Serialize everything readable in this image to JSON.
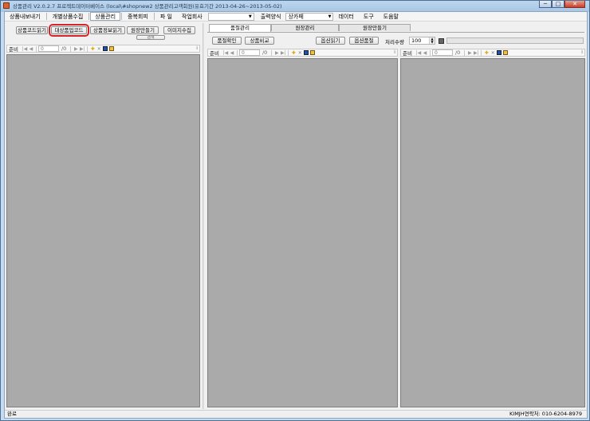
{
  "window": {
    "title": "상품관리 V2.0.2.7 프로젝트데이터베이스 (local\\#shopnew2 상품관리고객회원(유효기간 2013-04-26~2013-05-02)",
    "minimize": "─",
    "maximize": "□",
    "close": "✕"
  },
  "menu": {
    "items": [
      "상품내보내기",
      "개별상품수집",
      "상품관리",
      "중복회피",
      "파 일",
      "작업회사"
    ],
    "output_label": "출력양식",
    "output_value": "상카페",
    "extra_items": [
      "데이터",
      "도구",
      "도움말"
    ]
  },
  "left": {
    "buttons": {
      "product_code_load": "상품코드읽기",
      "bulk_upload_code": "대상품업코드",
      "product_info_load": "상품정보읽기",
      "form_create": "원장만들기",
      "image_collect": "이미지수집",
      "hidden_label": "검색"
    },
    "nav": {
      "ready": "준비",
      "position": "0",
      "of": "/0"
    }
  },
  "right": {
    "tabs": [
      "품절관리",
      "원장관리",
      "원장만들기"
    ],
    "buttons": {
      "soldout_check": "품절확인",
      "product_compare": "상품비교",
      "option_load": "옵션읽기",
      "option_soldout": "옵션품절"
    },
    "process_count_label": "처리수량",
    "process_count_value": "100",
    "progress_value": 0,
    "nav_middle": {
      "ready": "준비",
      "position": "0",
      "of": "/0"
    },
    "nav_right": {
      "ready": "준비",
      "position": "0",
      "of": "/0"
    }
  },
  "status": {
    "left": "완료",
    "right": "KIMJH연락처: 010-6204-8979"
  },
  "colors": {
    "grid": "#aaaaaa",
    "highlight": "#d4252b",
    "progress": "#3db03d"
  }
}
